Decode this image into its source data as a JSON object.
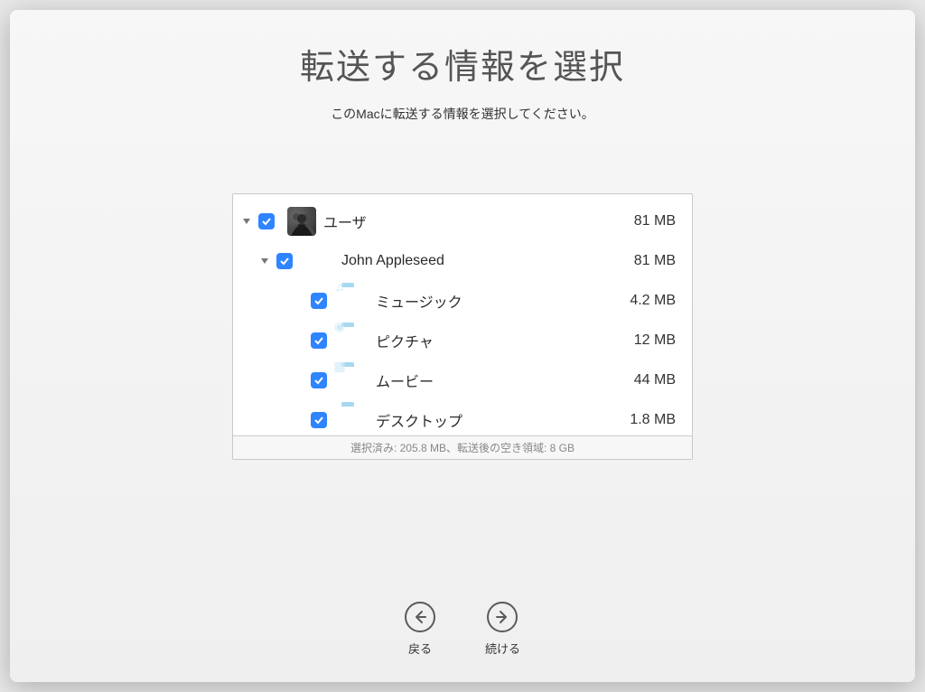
{
  "title": "転送する情報を選択",
  "subtitle": "このMacに転送する情報を選択してください。",
  "tree": {
    "users": {
      "label": "ユーザ",
      "size": "81 MB"
    },
    "user1": {
      "label": "John Appleseed",
      "size": "81 MB"
    },
    "music": {
      "label": "ミュージック",
      "size": "4.2 MB"
    },
    "pictures": {
      "label": "ピクチャ",
      "size": "12 MB"
    },
    "movies": {
      "label": "ムービー",
      "size": "44 MB"
    },
    "desktop": {
      "label": "デスクトップ",
      "size": "1.8 MB"
    }
  },
  "status": "選択済み: 205.8 MB、転送後の空き領域: 8 GB",
  "buttons": {
    "back": "戻る",
    "continue": "続ける"
  }
}
